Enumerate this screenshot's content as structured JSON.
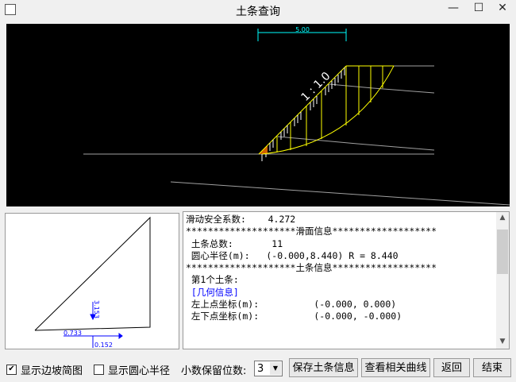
{
  "window": {
    "title": "土条查询",
    "minimize": "—",
    "maximize": "☐",
    "close": "✕"
  },
  "drawing": {
    "dimension_label": "5.00",
    "slope_label": "1 : 1.0"
  },
  "mini_diagram": {
    "labels": [
      "0.733",
      "0.152",
      "3.153"
    ]
  },
  "info": {
    "lines": [
      {
        "text": "滑动安全系数:    4.272",
        "color": "black"
      },
      {
        "text": "",
        "color": "black"
      },
      {
        "text": "********************滑面信息*******************",
        "color": "black"
      },
      {
        "text": " 土条总数:       11",
        "color": "black"
      },
      {
        "text": " 圆心半径(m):   (-0.000,8.440) R = 8.440",
        "color": "black"
      },
      {
        "text": "",
        "color": "black"
      },
      {
        "text": "********************土条信息*******************",
        "color": "black"
      },
      {
        "text": " 第1个土条:",
        "color": "black"
      },
      {
        "text": " [几何信息]",
        "color": "blue"
      },
      {
        "text": " 左上点坐标(m):          (-0.000, 0.000)",
        "color": "black"
      },
      {
        "text": " 左下点坐标(m):          (-0.000, -0.000)",
        "color": "black"
      }
    ]
  },
  "controls": {
    "show_slope_sketch": {
      "label": "显示边坡简图",
      "checked": true
    },
    "show_circle_radius": {
      "label": "显示圆心半径",
      "checked": false
    },
    "decimal_label": "小数保留位数:",
    "decimal_value": "3",
    "save_button": "保存土条信息",
    "curves_button": "查看相关曲线",
    "back_button": "返回",
    "end_button": "结束"
  }
}
